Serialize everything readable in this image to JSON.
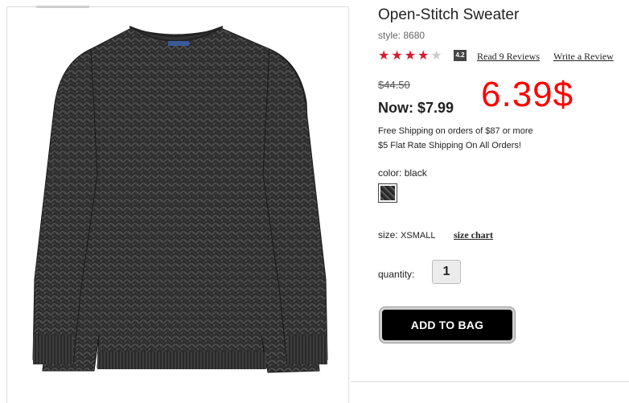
{
  "product": {
    "title": "Open-Stitch Sweater",
    "style_label": "style:",
    "style_number": "8680",
    "rating": 4.2,
    "rating_badge": "4.2",
    "stars_total": 5,
    "stars_filled": 4,
    "reviews_link": "Read 9 Reviews",
    "write_review_link": "Write a Review",
    "old_price": "$44.50",
    "now_label": "Now:",
    "now_price": "$7.99",
    "handwritten_price": "6.39$",
    "shipping_line1": "Free Shipping on orders of $87 or more",
    "shipping_line2": "$5 Flat Rate Shipping On All Orders!",
    "color_label": "color:",
    "color_value": "black",
    "size_label": "size:",
    "size_value": "XSMALL",
    "size_chart_link": "size chart",
    "quantity_label": "quantity:",
    "quantity_value": "1",
    "add_to_bag_label": "ADD TO BAG"
  },
  "colors": {
    "star_on": "#d41b2c",
    "star_off": "#cccccc",
    "handwritten": "#ff0000",
    "button_bg": "#000000"
  },
  "icons": {
    "star": "star-icon",
    "swatch": "color-swatch"
  }
}
